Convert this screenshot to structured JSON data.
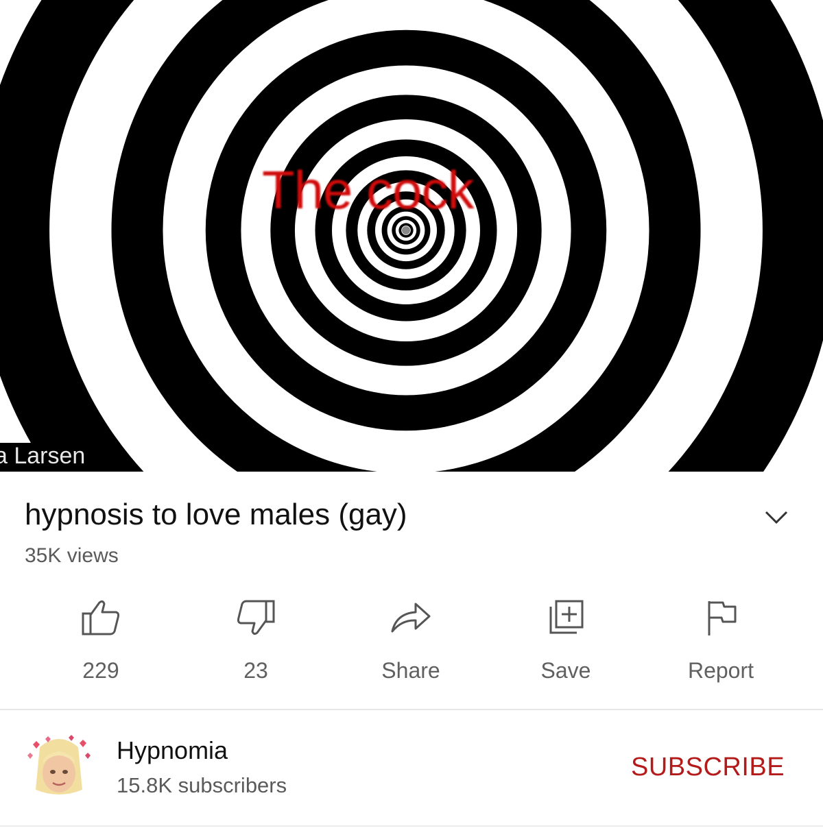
{
  "video": {
    "overlay_text": "The cock",
    "watermark": "a Larsen"
  },
  "info": {
    "title": "hypnosis to love males (gay)",
    "views": "35K views"
  },
  "actions": [
    {
      "icon": "thumbs-up-icon",
      "label": "229"
    },
    {
      "icon": "thumbs-down-icon",
      "label": "23"
    },
    {
      "icon": "share-icon",
      "label": "Share"
    },
    {
      "icon": "save-playlist-icon",
      "label": "Save"
    },
    {
      "icon": "flag-icon",
      "label": "Report"
    }
  ],
  "channel": {
    "name": "Hypnomia",
    "subscribers": "15.8K subscribers",
    "subscribe_label": "SUBSCRIBE"
  },
  "colors": {
    "subscribe": "#b31b1b",
    "overlay_text": "#d10b0b"
  }
}
